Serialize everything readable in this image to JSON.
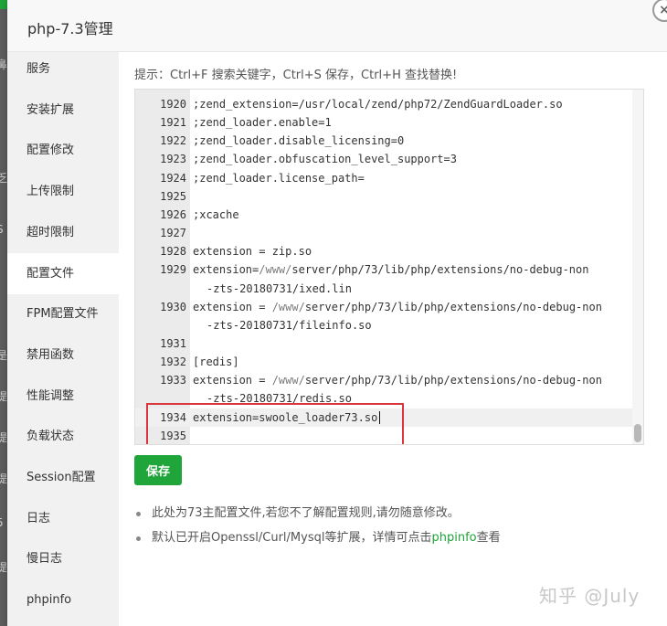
{
  "dialog": {
    "title": "php-7.3管理",
    "close_glyph": "×"
  },
  "background_fragments": [
    "鼻",
    "乏",
    "S",
    "是",
    "提",
    "提",
    "提",
    "5",
    "提"
  ],
  "sidebar": {
    "items": [
      {
        "label": "服务",
        "active": false
      },
      {
        "label": "安装扩展",
        "active": false
      },
      {
        "label": "配置修改",
        "active": false
      },
      {
        "label": "上传限制",
        "active": false
      },
      {
        "label": "超时限制",
        "active": false
      },
      {
        "label": "配置文件",
        "active": true
      },
      {
        "label": "FPM配置文件",
        "active": false
      },
      {
        "label": "禁用函数",
        "active": false
      },
      {
        "label": "性能调整",
        "active": false
      },
      {
        "label": "负载状态",
        "active": false
      },
      {
        "label": "Session配置",
        "active": false
      },
      {
        "label": "日志",
        "active": false
      },
      {
        "label": "慢日志",
        "active": false
      },
      {
        "label": "phpinfo",
        "active": false
      }
    ]
  },
  "hint": "提示：Ctrl+F 搜索关键字，Ctrl+S 保存，Ctrl+H 查找替换!",
  "editor": {
    "lines": [
      {
        "num": "1920",
        "parts": [
          {
            "t": ";zend_extension=/usr/local/zend/php72/ZendGuardLoader.so"
          }
        ]
      },
      {
        "num": "1921",
        "parts": [
          {
            "t": ";zend_loader.enable=1"
          }
        ]
      },
      {
        "num": "1922",
        "parts": [
          {
            "t": ";zend_loader.disable_licensing=0"
          }
        ]
      },
      {
        "num": "1923",
        "parts": [
          {
            "t": ";zend_loader.obfuscation_level_support=3"
          }
        ]
      },
      {
        "num": "1924",
        "parts": [
          {
            "t": ";zend_loader.license_path="
          }
        ]
      },
      {
        "num": "1925",
        "parts": []
      },
      {
        "num": "1926",
        "parts": [
          {
            "t": ";xcache"
          }
        ]
      },
      {
        "num": "1927",
        "parts": []
      },
      {
        "num": "1928",
        "parts": [
          {
            "t": "extension = zip.so"
          }
        ]
      },
      {
        "num": "1929",
        "parts": [
          {
            "t": "extension="
          },
          {
            "t": "/www/",
            "p": true
          },
          {
            "t": "server/php/73/lib/php/extensions/no-debug-non"
          }
        ]
      },
      {
        "num": "",
        "cont": true,
        "parts": [
          {
            "t": "-zts-20180731/ixed.lin"
          }
        ]
      },
      {
        "num": "1930",
        "parts": [
          {
            "t": "extension = "
          },
          {
            "t": "/www/",
            "p": true
          },
          {
            "t": "server/php/73/lib/php/extensions/no-debug-non"
          }
        ]
      },
      {
        "num": "",
        "cont": true,
        "parts": [
          {
            "t": "-zts-20180731/fileinfo.so"
          }
        ]
      },
      {
        "num": "1931",
        "parts": []
      },
      {
        "num": "1932",
        "parts": [
          {
            "t": "[redis]"
          }
        ]
      },
      {
        "num": "1933",
        "parts": [
          {
            "t": "extension = "
          },
          {
            "t": "/www/",
            "p": true
          },
          {
            "t": "server/php/73/lib/php/extensions/no-debug-non"
          }
        ]
      },
      {
        "num": "",
        "cont": true,
        "parts": [
          {
            "t": "-zts-20180731/redis.so"
          }
        ]
      },
      {
        "num": "1934",
        "current": true,
        "cursor": true,
        "parts": [
          {
            "t": "extension=swoole_loader73.so"
          }
        ]
      },
      {
        "num": "1935",
        "parts": []
      }
    ]
  },
  "save_button": "保存",
  "notes": [
    {
      "text": "此处为73主配置文件,若您不了解配置规则,请勿随意修改。",
      "link": "",
      "after": ""
    },
    {
      "text": "默认已开启Openssl/Curl/Mysql等扩展，详情可点击",
      "link": "phpinfo",
      "after": "查看"
    }
  ],
  "watermark": "知乎 @July",
  "colors": {
    "accent": "#20a53a",
    "highlight_box": "#d9363e"
  },
  "icons": {
    "close": "close-icon",
    "cursor": "text-cursor-icon"
  }
}
